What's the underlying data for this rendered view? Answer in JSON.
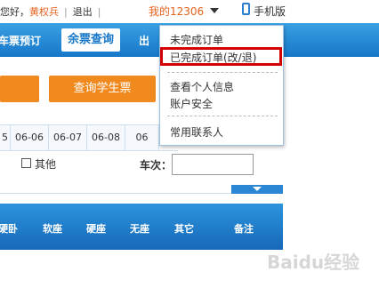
{
  "topbar": {
    "greeting": "您好，",
    "user": "黄权兵",
    "logout": "退出",
    "my12306": "我的12306",
    "mobile": "手机版"
  },
  "nav": {
    "item_left": "车票预订",
    "active": "余票查询",
    "item_right": "出"
  },
  "buttons": {
    "student_query": "查询学生票"
  },
  "dates": [
    "5",
    "06-06",
    "06-07",
    "06-08",
    "06"
  ],
  "filters": {
    "other_label": "其他",
    "train_label": "车次："
  },
  "table_headers": [
    "硬卧",
    "软座",
    "硬座",
    "无座",
    "其它",
    "备注"
  ],
  "dropdown": {
    "items": [
      "未完成订单",
      "已完成订单(改/退)",
      "查看个人信息",
      "账户安全",
      "常用联系人"
    ]
  },
  "watermark": "Baidu经验",
  "colors": {
    "nav_blue": "#1677c8",
    "orange": "#f08a1f",
    "highlight_red": "#d40000",
    "user_orange": "#e5611b"
  }
}
